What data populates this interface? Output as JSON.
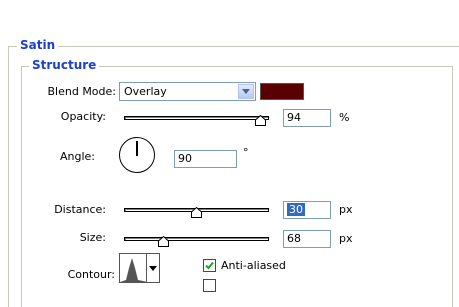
{
  "group_title": "Satin",
  "section_title": "Structure",
  "blend_mode": {
    "label": "Blend Mode:",
    "value": "Overlay",
    "color": "#5a0000"
  },
  "opacity": {
    "label": "Opacity:",
    "value": "94",
    "unit": "%",
    "level": 0.94
  },
  "angle": {
    "label": "Angle:",
    "value": "90",
    "unit": "°"
  },
  "distance": {
    "label": "Distance:",
    "value": "30",
    "unit": "px",
    "level": 0.5
  },
  "size": {
    "label": "Size:",
    "value": "68",
    "unit": "px",
    "level": 0.27
  },
  "contour": {
    "label": "Contour:",
    "anti_aliased_label": "Anti-aliased",
    "anti_aliased_checked": true
  },
  "colors": {
    "legend": "#1c3fd0",
    "border": "#c9c7ba",
    "selection": "#316ac5"
  }
}
